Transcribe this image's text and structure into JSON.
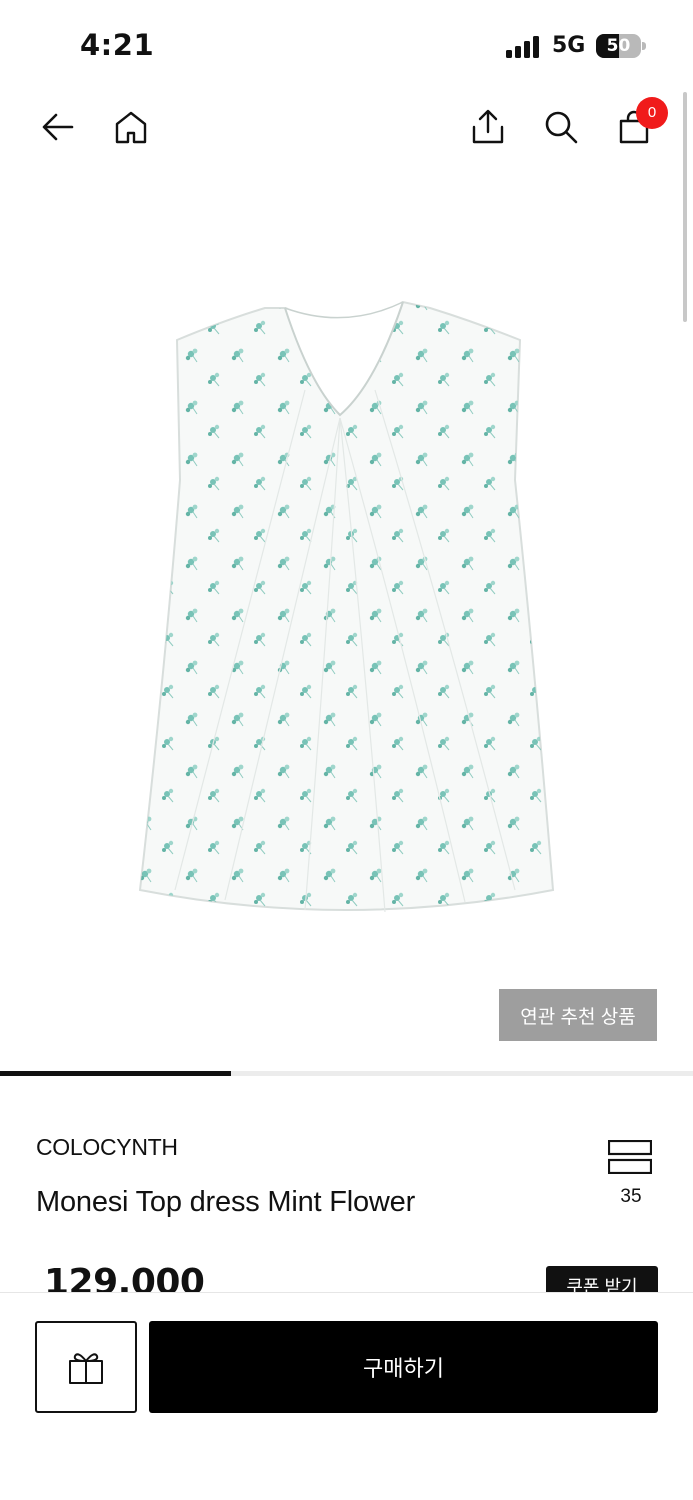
{
  "status_bar": {
    "time": "4:21",
    "network": "5G",
    "battery_percent": "50",
    "battery_level": 0.5
  },
  "nav": {
    "icons": [
      "back-arrow-icon",
      "home-icon",
      "share-icon",
      "search-icon",
      "shopping-bag-icon"
    ],
    "cart_count": "0"
  },
  "product_image": {
    "description_icon": "dress-image",
    "accent_color": "#5fb8a9"
  },
  "related_button": {
    "label": "연관 추천 상품"
  },
  "gallery": {
    "progress": 0.333
  },
  "product": {
    "brand": "COLOCYNTH",
    "name": "Monesi Top dress Mint Flower",
    "wishlist_count": "35",
    "price": "129,000"
  },
  "coupon_button": {
    "label": "쿠폰 받기"
  },
  "bottom_bar": {
    "gift_icon": "gift-icon",
    "buy_label": "구매하기"
  },
  "colors": {
    "badge": "#f01b1b",
    "buy_button": "#000000",
    "related_button": "#9e9e9e"
  }
}
